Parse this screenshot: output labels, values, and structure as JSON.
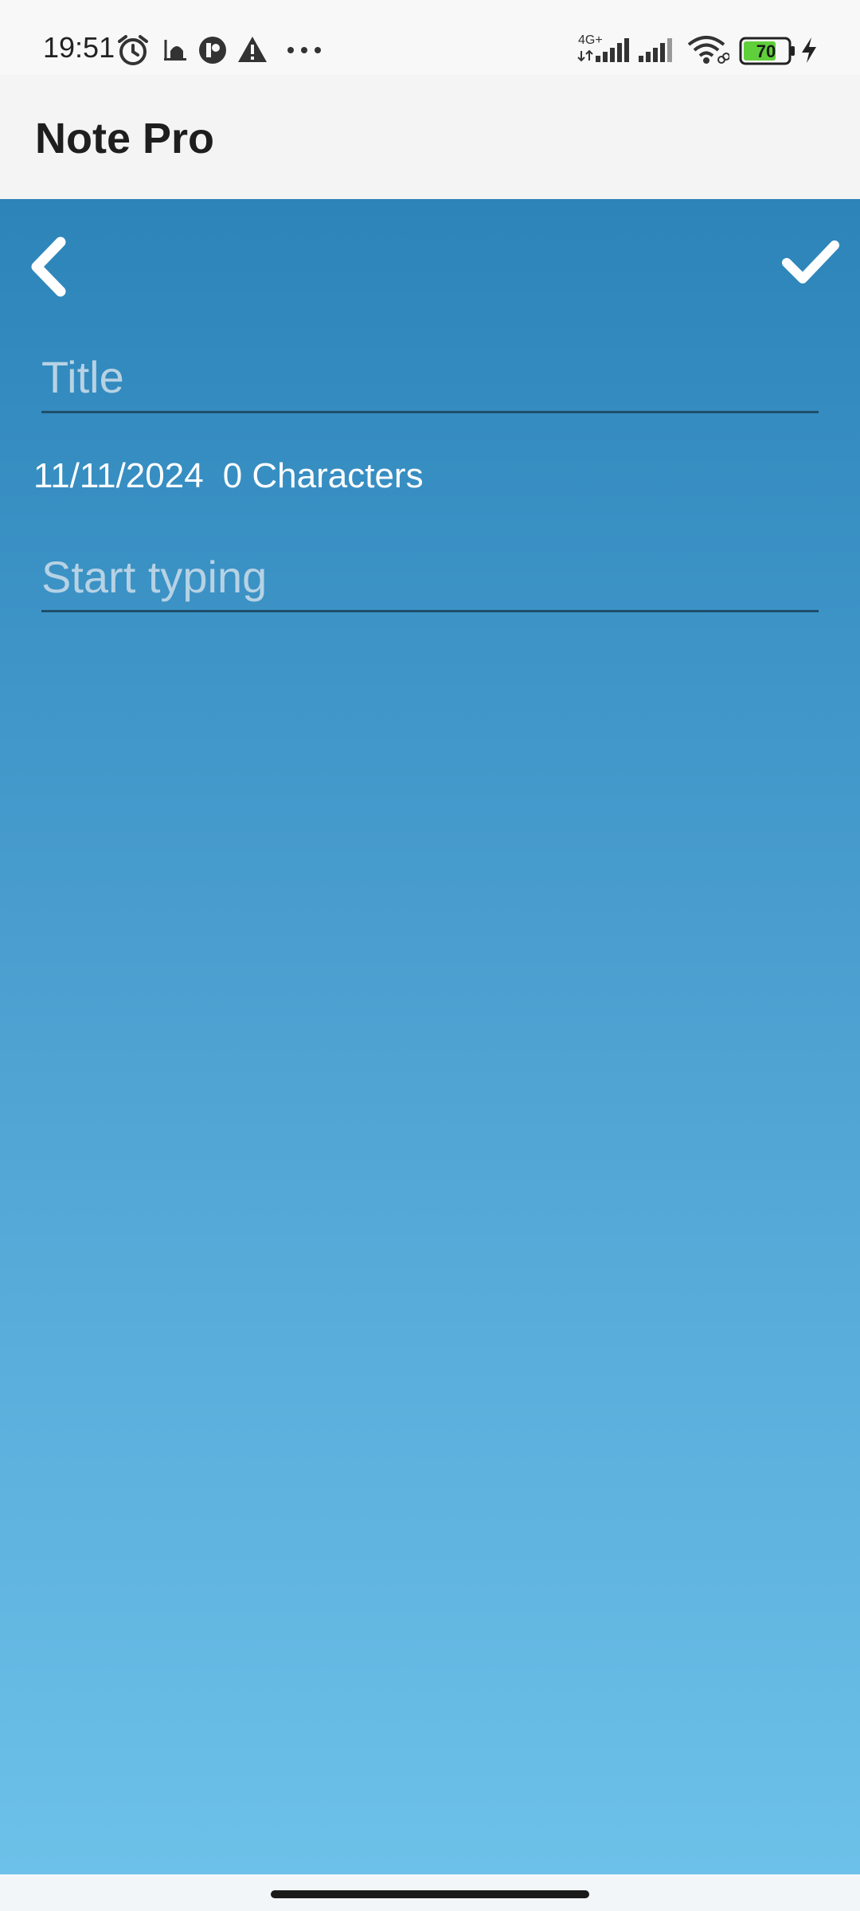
{
  "status_bar": {
    "time": "19:51",
    "network_type": "4G+",
    "battery_level": "70",
    "icons": [
      "alarm-icon",
      "mosque-icon",
      "app-notification-icon",
      "warning-icon",
      "more-dots-icon",
      "signal-icon",
      "signal-icon-2",
      "wifi-icon",
      "battery-icon",
      "charging-icon"
    ],
    "battery_color": "#5fcf3a"
  },
  "app_bar": {
    "title": "Note Pro"
  },
  "editor": {
    "back_icon": "chevron-left-icon",
    "save_icon": "checkmark-icon",
    "title_placeholder": "Title",
    "date": "11/11/2024",
    "character_count": "0 Characters",
    "body_placeholder": "Start typing",
    "gradient_top": "#2c84b9",
    "gradient_bottom": "#6cc1e9"
  }
}
